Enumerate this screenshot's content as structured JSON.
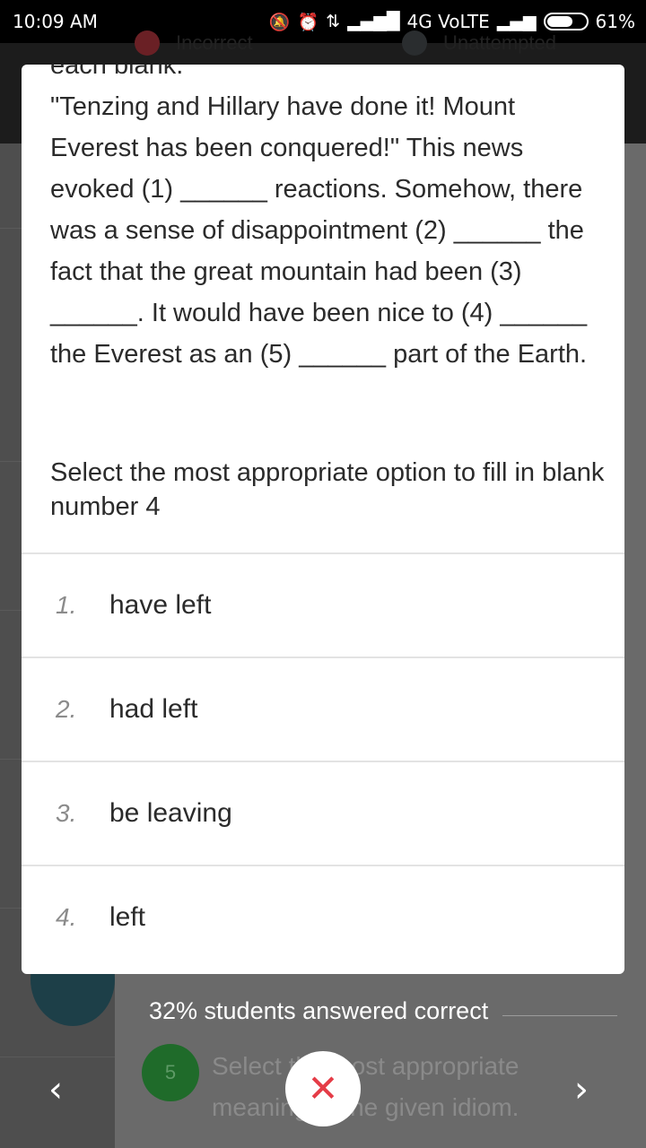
{
  "status_bar": {
    "time": "10:09 AM",
    "network": "4G VoLTE",
    "battery": "61%"
  },
  "legend": {
    "incorrect": "Incorrect",
    "unattempted": "Unattempted"
  },
  "question": {
    "passage_top": "each blank.",
    "passage": "\"Tenzing and Hillary have done it! Mount Everest has been conquered!\" This news evoked (1) ______ reactions. Somehow, there was a sense of disappointment (2) ______ the fact that the great mountain had been (3) ______. It would have been nice to (4) ______ the Everest as an (5) ______ part of the Earth.",
    "prompt": "Select the most appropriate option to fill in blank number 4",
    "options": [
      {
        "num": "1.",
        "label": "have left"
      },
      {
        "num": "2.",
        "label": "had left"
      },
      {
        "num": "3.",
        "label": "be leaving"
      },
      {
        "num": "4.",
        "label": "left"
      }
    ]
  },
  "footer": {
    "answered_correct": "32% students answered correct",
    "next_question_number": "5",
    "next_question_text": "Select the most appropriate meaning of the given idiom."
  },
  "colors": {
    "incorrect_dot": "#c62f3a",
    "unattempted_dot": "#4a4f52",
    "close_x": "#e53c47"
  }
}
